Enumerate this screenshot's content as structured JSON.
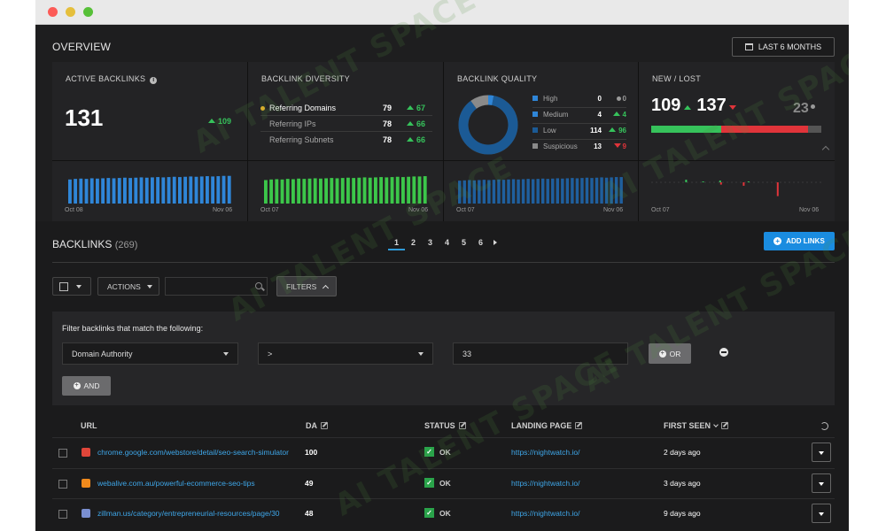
{
  "window": {
    "titlebar_buttons": [
      "close",
      "minimize",
      "zoom"
    ]
  },
  "overview": {
    "title": "OVERVIEW",
    "date_range_label": "LAST 6 MONTHS",
    "active_backlinks": {
      "title": "ACTIVE BACKLINKS",
      "value": "131",
      "delta": "109",
      "date_start": "Oct 08",
      "date_end": "Nov 06",
      "bar_color": "#2f86d8",
      "spark_values": [
        0.8,
        0.82,
        0.83,
        0.82,
        0.84,
        0.83,
        0.84,
        0.85,
        0.84,
        0.85,
        0.86,
        0.85,
        0.86,
        0.87,
        0.86,
        0.87,
        0.88,
        0.87,
        0.88,
        0.89,
        0.88,
        0.89,
        0.9,
        0.89,
        0.9,
        0.91,
        0.9,
        0.91,
        0.92,
        0.92
      ]
    },
    "diversity": {
      "title": "BACKLINK DIVERSITY",
      "rows": [
        {
          "label": "Referring Domains",
          "value": "79",
          "delta": "67"
        },
        {
          "label": "Referring IPs",
          "value": "78",
          "delta": "66"
        },
        {
          "label": "Referring Subnets",
          "value": "78",
          "delta": "66"
        }
      ],
      "date_start": "Oct 07",
      "date_end": "Nov 06",
      "bar_color": "#3cc74a",
      "spark_values": [
        0.78,
        0.8,
        0.81,
        0.8,
        0.82,
        0.81,
        0.83,
        0.82,
        0.83,
        0.84,
        0.83,
        0.84,
        0.85,
        0.84,
        0.85,
        0.86,
        0.85,
        0.86,
        0.87,
        0.86,
        0.87,
        0.88,
        0.87,
        0.88,
        0.89,
        0.88,
        0.89,
        0.9,
        0.9,
        0.91
      ]
    },
    "quality": {
      "title": "BACKLINK QUALITY",
      "rows": [
        {
          "label": "High",
          "value": "0",
          "delta": "0",
          "color": "#2f86d8",
          "trend": "none"
        },
        {
          "label": "Medium",
          "value": "4",
          "delta": "4",
          "color": "#2f86d8",
          "trend": "up"
        },
        {
          "label": "Low",
          "value": "114",
          "delta": "96",
          "color": "#1b5a95",
          "trend": "up"
        },
        {
          "label": "Suspicious",
          "value": "13",
          "delta": "9",
          "color": "#8a8a8a",
          "trend": "down"
        }
      ],
      "donut_shares": [
        0.0,
        0.03,
        0.87,
        0.1
      ],
      "date_start": "Oct 07",
      "date_end": "Nov 06",
      "bar_color": "#1f5f9e",
      "spark_values": [
        0.76,
        0.77,
        0.78,
        0.77,
        0.78,
        0.79,
        0.78,
        0.79,
        0.8,
        0.79,
        0.8,
        0.81,
        0.8,
        0.81,
        0.82,
        0.81,
        0.82,
        0.83,
        0.82,
        0.83,
        0.84,
        0.83,
        0.84,
        0.85,
        0.84,
        0.85,
        0.86,
        0.85,
        0.86,
        0.87,
        0.86,
        0.87,
        0.88,
        0.88
      ]
    },
    "new_lost": {
      "title": "NEW / LOST",
      "new_value": "109",
      "lost_value": "137",
      "other_value": "23",
      "new_share": 0.41,
      "lost_share": 0.51,
      "date_start": "Oct 07",
      "date_end": "Nov 06",
      "spark_new": [
        0,
        0,
        0,
        0,
        0,
        0,
        0.15,
        0,
        0,
        0.05,
        0,
        0,
        0.1,
        0,
        0,
        0,
        0,
        0.05,
        0,
        0,
        0,
        0,
        0,
        0,
        0,
        0,
        0,
        0,
        0,
        0
      ],
      "spark_lost": [
        0,
        0,
        0,
        0,
        0,
        0,
        0,
        0,
        0,
        0,
        0,
        0,
        0.1,
        0,
        0,
        0,
        0.15,
        0,
        0,
        0,
        0,
        0,
        0.6,
        0,
        0,
        0,
        0,
        0,
        0,
        0
      ]
    }
  },
  "backlinks": {
    "title": "BACKLINKS",
    "count": "(269)",
    "pages": [
      "1",
      "2",
      "3",
      "4",
      "5",
      "6"
    ],
    "active_page": "1",
    "add_links_label": "ADD LINKS",
    "actions_label": "ACTIONS",
    "filters_label": "FILTERS",
    "search_placeholder": ""
  },
  "filter": {
    "heading": "Filter backlinks that match the following:",
    "field": "Domain Authority",
    "operator": ">",
    "value": "33",
    "or_label": "OR",
    "and_label": "AND"
  },
  "table": {
    "headers": {
      "url": "URL",
      "da": "DA",
      "status": "STATUS",
      "landing": "LANDING PAGE",
      "first_seen": "FIRST SEEN"
    },
    "rows": [
      {
        "url": "chrome.google.com/webstore/detail/seo-search-simulator",
        "da": "100",
        "status": "OK",
        "landing": "https://nightwatch.io/",
        "first_seen": "2 days ago",
        "favicon_color": "#e0463a"
      },
      {
        "url": "webalive.com.au/powerful-ecommerce-seo-tips",
        "da": "49",
        "status": "OK",
        "landing": "https://nightwatch.io/",
        "first_seen": "3 days ago",
        "favicon_color": "#f08a1c"
      },
      {
        "url": "zillman.us/category/entrepreneurial-resources/page/30",
        "da": "48",
        "status": "OK",
        "landing": "https://nightwatch.io/",
        "first_seen": "9 days ago",
        "favicon_color": "#7a8fd0"
      }
    ]
  },
  "watermark": "AI TALENT SPACE"
}
